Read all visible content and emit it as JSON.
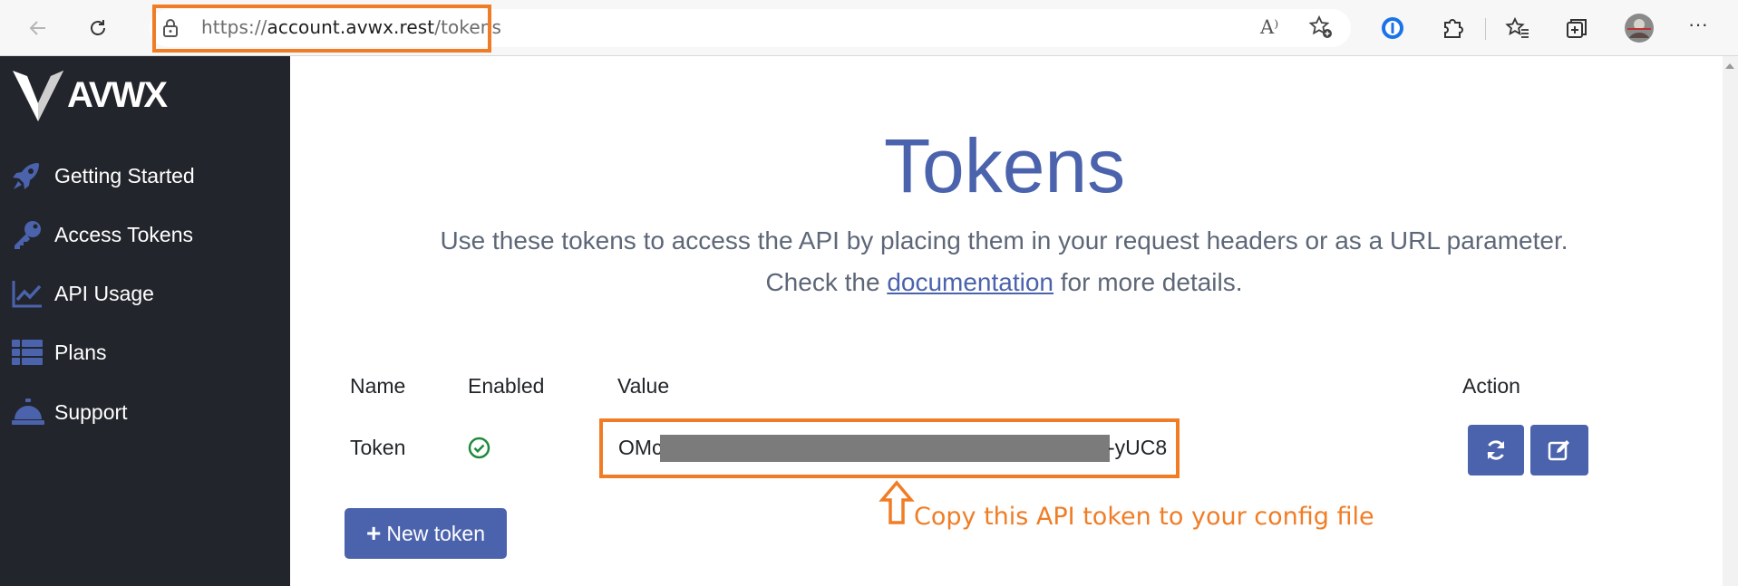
{
  "browser": {
    "url_prefix": "https://",
    "url_host": "account.avwx.rest",
    "url_path": "/tokens",
    "read_aloud_glyph": "A⁾",
    "more_glyph": "···"
  },
  "sidebar": {
    "logo_text": "AVWX",
    "items": [
      {
        "label": "Getting Started",
        "icon": "rocket-icon"
      },
      {
        "label": "Access Tokens",
        "icon": "key-icon"
      },
      {
        "label": "API Usage",
        "icon": "chart-line-icon"
      },
      {
        "label": "Plans",
        "icon": "list-icon"
      },
      {
        "label": "Support",
        "icon": "concierge-bell-icon"
      }
    ]
  },
  "page": {
    "title": "Tokens",
    "subtitle_line1": "Use these tokens to access the API by placing them in your request headers or as a URL parameter.",
    "subtitle_pre": "Check the ",
    "subtitle_link": "documentation",
    "subtitle_post": " for more details."
  },
  "table": {
    "headers": {
      "name": "Name",
      "enabled": "Enabled",
      "value": "Value",
      "action": "Action"
    },
    "rows": [
      {
        "name": "Token",
        "enabled": true,
        "value_start": "OMc",
        "value_end": "-yUC8"
      }
    ]
  },
  "buttons": {
    "new_token": "New token",
    "new_token_plus": "+"
  },
  "annotation": {
    "text": "Copy this API token to your config file"
  },
  "colors": {
    "accent": "#4b63ad",
    "sidebar_bg": "#22252b",
    "highlight": "#f07d26",
    "success": "#1e8a3c"
  }
}
